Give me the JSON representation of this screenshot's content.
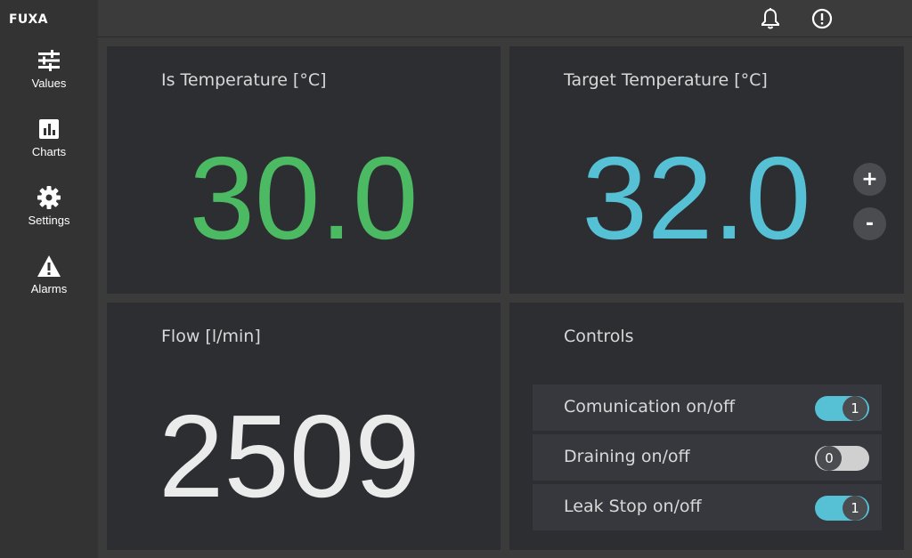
{
  "app": {
    "brand": "FUXA"
  },
  "sidebar": {
    "items": [
      {
        "label": "Values",
        "icon": "sliders-icon"
      },
      {
        "label": "Charts",
        "icon": "bar-chart-icon"
      },
      {
        "label": "Settings",
        "icon": "gear-icon"
      },
      {
        "label": "Alarms",
        "icon": "warning-icon"
      }
    ]
  },
  "topbar": {
    "icons": [
      "bell-icon",
      "exclamation-circle-icon"
    ]
  },
  "panels": {
    "is_temp": {
      "title": "Is Temperature [°C]",
      "value": "30.0",
      "color": "#4cb963"
    },
    "target_temp": {
      "title": "Target Temperature [°C]",
      "value": "32.0",
      "color": "#56c1d5",
      "plus_label": "+",
      "minus_label": "-"
    },
    "flow": {
      "title": "Flow [l/min]",
      "value": "2509",
      "color": "#ebebeb"
    },
    "controls": {
      "title": "Controls",
      "rows": [
        {
          "label": "Comunication on/off",
          "state": "1",
          "on": true
        },
        {
          "label": "Draining on/off",
          "state": "0",
          "on": false
        },
        {
          "label": "Leak Stop on/off",
          "state": "1",
          "on": true
        }
      ]
    }
  },
  "colors": {
    "toggle_on": "#56c1d5",
    "toggle_off": "#d0d0d0"
  }
}
